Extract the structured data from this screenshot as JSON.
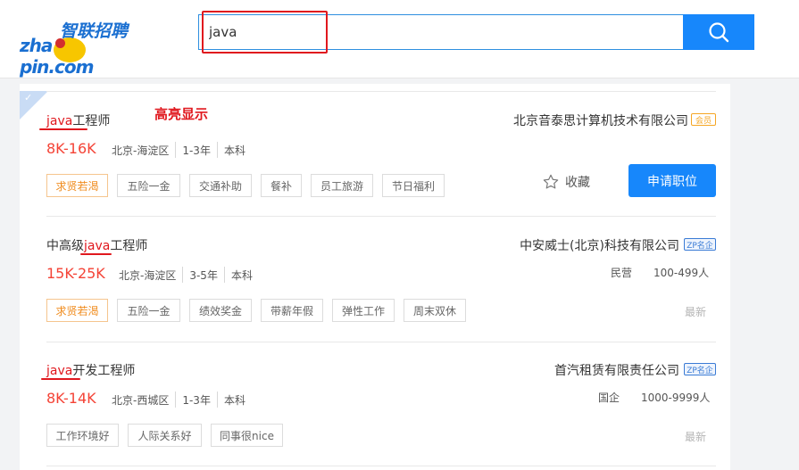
{
  "header": {
    "logo_cn": "智联招聘",
    "logo_en_pre": "zha",
    "logo_en_post": "pin.com",
    "search_value": "java"
  },
  "annotation": "高亮显示",
  "jobs": [
    {
      "title_keyword": "java",
      "title_suffix": "工程师",
      "salary": "8K-16K",
      "location": "北京-海淀区",
      "experience": "1-3年",
      "education": "本科",
      "tags": [
        "求贤若渴",
        "五险一金",
        "交通补助",
        "餐补",
        "员工旅游",
        "节日福利"
      ],
      "company": "北京音泰思计算机技术有限公司",
      "company_badge": "会员",
      "favorite_label": "收藏",
      "apply_label": "申请职位"
    },
    {
      "title_prefix": "中高级",
      "title_keyword": "java",
      "title_suffix": "工程师",
      "salary": "15K-25K",
      "location": "北京-海淀区",
      "experience": "3-5年",
      "education": "本科",
      "tags": [
        "求贤若渴",
        "五险一金",
        "绩效奖金",
        "带薪年假",
        "弹性工作",
        "周末双休"
      ],
      "company": "中安威士(北京)科技有限公司",
      "company_badge": "ZP名企",
      "company_type": "民营",
      "company_size": "100-499人",
      "status": "最新"
    },
    {
      "title_keyword": "java",
      "title_suffix": "开发工程师",
      "salary": "8K-14K",
      "location": "北京-西城区",
      "experience": "1-3年",
      "education": "本科",
      "tags": [
        "工作环境好",
        "人际关系好",
        "同事很nice"
      ],
      "company": "首汽租赁有限责任公司",
      "company_badge": "ZP名企",
      "company_type": "国企",
      "company_size": "1000-9999人",
      "status": "最新"
    }
  ],
  "colors": {
    "accent": "#1787fb",
    "highlight": "#e0181e",
    "salary": "#f44336",
    "hot_tag": "#f08c1e"
  }
}
